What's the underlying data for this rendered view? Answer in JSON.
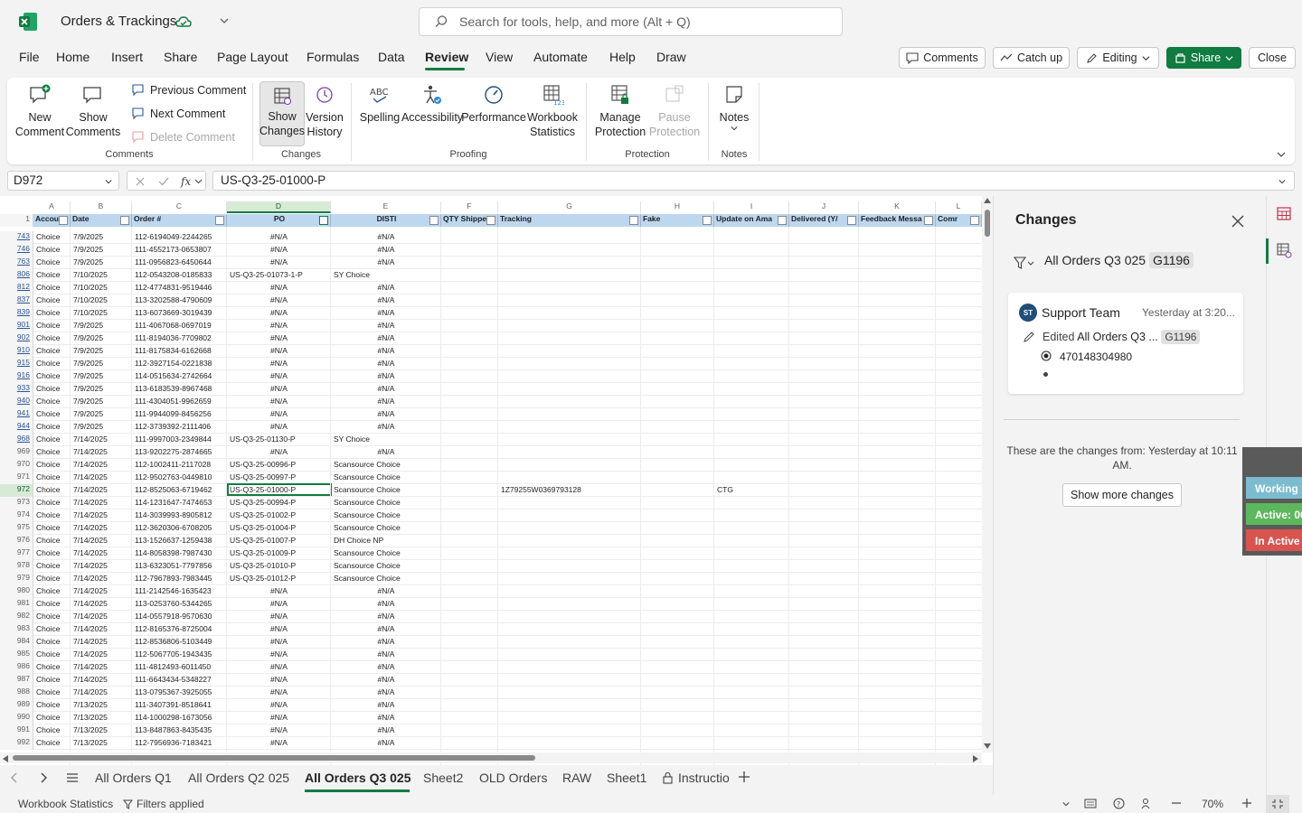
{
  "app": {
    "title": "Orders & Trackings",
    "search_placeholder": "Search for tools, help, and more (Alt + Q)"
  },
  "menu": {
    "tabs": [
      "File",
      "Home",
      "Insert",
      "Share",
      "Page Layout",
      "Formulas",
      "Data",
      "Review",
      "View",
      "Automate",
      "Help",
      "Draw"
    ],
    "active": "Review",
    "comments": "Comments",
    "catch_up": "Catch up",
    "editing": "Editing",
    "share": "Share",
    "close": "Close"
  },
  "ribbon": {
    "new_comment": "New Comment",
    "show_comments": "Show Comments",
    "previous_comment": "Previous Comment",
    "next_comment": "Next Comment",
    "delete_comment": "Delete Comment",
    "group_comments": "Comments",
    "show_changes": "Show Changes",
    "version_history": "Version History",
    "group_changes": "Changes",
    "spelling": "Spelling",
    "accessibility": "Accessibility",
    "performance": "Performance",
    "workbook_statistics": "Workbook Statistics",
    "group_proofing": "Proofing",
    "manage_protection": "Manage Protection",
    "pause_protection": "Pause Protection",
    "group_protection": "Protection",
    "notes": "Notes",
    "group_notes": "Notes"
  },
  "formula_bar": {
    "name_box": "D972",
    "formula": "US-Q3-25-01000-P"
  },
  "grid": {
    "columns": [
      "A",
      "B",
      "C",
      "D",
      "E",
      "F",
      "G",
      "H",
      "I",
      "J",
      "K",
      "L"
    ],
    "headers": [
      "Accou",
      "Date",
      "Order #",
      "PO",
      "DISTI",
      "QTY Shippe",
      "Tracking",
      "Fake",
      "Update on Ama",
      "Delivered (Y/",
      "Feedback Messa",
      "Comr"
    ],
    "rows": [
      {
        "n": "743",
        "a": "Choice",
        "b": "7/9/2025",
        "c": "112-6194049-2244265",
        "d": "#N/A",
        "e": "#N/A"
      },
      {
        "n": "746",
        "a": "Choice",
        "b": "7/9/2025",
        "c": "111-4552173-0653807",
        "d": "#N/A",
        "e": "#N/A"
      },
      {
        "n": "763",
        "a": "Choice",
        "b": "7/9/2025",
        "c": "111-0956823-6450644",
        "d": "#N/A",
        "e": "#N/A"
      },
      {
        "n": "806",
        "a": "Choice",
        "b": "7/10/2025",
        "c": "112-0543208-0185833",
        "d": "US-Q3-25-01073-1-P",
        "e": "SY Choice"
      },
      {
        "n": "812",
        "a": "Choice",
        "b": "7/10/2025",
        "c": "112-4774831-9519446",
        "d": "#N/A",
        "e": "#N/A"
      },
      {
        "n": "837",
        "a": "Choice",
        "b": "7/10/2025",
        "c": "113-3202588-4790609",
        "d": "#N/A",
        "e": "#N/A"
      },
      {
        "n": "839",
        "a": "Choice",
        "b": "7/10/2025",
        "c": "113-6073669-3019439",
        "d": "#N/A",
        "e": "#N/A"
      },
      {
        "n": "901",
        "a": "Choice",
        "b": "7/9/2025",
        "c": "111-4067068-0697019",
        "d": "#N/A",
        "e": "#N/A"
      },
      {
        "n": "902",
        "a": "Choice",
        "b": "7/9/2025",
        "c": "111-8194036-7709802",
        "d": "#N/A",
        "e": "#N/A"
      },
      {
        "n": "910",
        "a": "Choice",
        "b": "7/9/2025",
        "c": "111-8175834-6162668",
        "d": "#N/A",
        "e": "#N/A"
      },
      {
        "n": "915",
        "a": "Choice",
        "b": "7/9/2025",
        "c": "112-3927154-0221838",
        "d": "#N/A",
        "e": "#N/A"
      },
      {
        "n": "916",
        "a": "Choice",
        "b": "7/9/2025",
        "c": "114-0515634-2742664",
        "d": "#N/A",
        "e": "#N/A"
      },
      {
        "n": "933",
        "a": "Choice",
        "b": "7/9/2025",
        "c": "113-6183539-8967468",
        "d": "#N/A",
        "e": "#N/A"
      },
      {
        "n": "940",
        "a": "Choice",
        "b": "7/9/2025",
        "c": "111-4304051-9962659",
        "d": "#N/A",
        "e": "#N/A"
      },
      {
        "n": "941",
        "a": "Choice",
        "b": "7/9/2025",
        "c": "111-9944099-8456256",
        "d": "#N/A",
        "e": "#N/A"
      },
      {
        "n": "944",
        "a": "Choice",
        "b": "7/9/2025",
        "c": "112-3739392-2111406",
        "d": "#N/A",
        "e": "#N/A"
      },
      {
        "n": "968",
        "a": "Choice",
        "b": "7/14/2025",
        "c": "111-9997003-2349844",
        "d": "US-Q3-25-01130-P",
        "e": "SY Choice"
      },
      {
        "n": "969",
        "a": "Choice",
        "b": "7/14/2025",
        "c": "113-9202275-2874665",
        "d": "#N/A",
        "e": "#N/A"
      },
      {
        "n": "970",
        "a": "Choice",
        "b": "7/14/2025",
        "c": "112-1002411-2117028",
        "d": "US-Q3-25-00996-P",
        "e": "Scansource Choice"
      },
      {
        "n": "971",
        "a": "Choice",
        "b": "7/14/2025",
        "c": "112-9502763-0449810",
        "d": "US-Q3-25-00997-P",
        "e": "Scansource Choice"
      },
      {
        "n": "972",
        "a": "Choice",
        "b": "7/14/2025",
        "c": "112-8525063-6719462",
        "d": "US-Q3-25-01000-P",
        "e": "Scansource Choice",
        "g": "1Z79255W0369793128",
        "i": "CTG"
      },
      {
        "n": "973",
        "a": "Choice",
        "b": "7/14/2025",
        "c": "114-1231647-7474653",
        "d": "US-Q3-25-00994-P",
        "e": "Scansource Choice"
      },
      {
        "n": "974",
        "a": "Choice",
        "b": "7/14/2025",
        "c": "114-3039993-8905812",
        "d": "US-Q3-25-01002-P",
        "e": "Scansource Choice"
      },
      {
        "n": "975",
        "a": "Choice",
        "b": "7/14/2025",
        "c": "112-3620306-6708205",
        "d": "US-Q3-25-01004-P",
        "e": "Scansource Choice"
      },
      {
        "n": "976",
        "a": "Choice",
        "b": "7/14/2025",
        "c": "113-1526637-1259438",
        "d": "US-Q3-25-01007-P",
        "e": "DH Choice NP"
      },
      {
        "n": "977",
        "a": "Choice",
        "b": "7/14/2025",
        "c": "114-8058398-7987430",
        "d": "US-Q3-25-01009-P",
        "e": "Scansource Choice"
      },
      {
        "n": "978",
        "a": "Choice",
        "b": "7/14/2025",
        "c": "113-6323051-7797856",
        "d": "US-Q3-25-01010-P",
        "e": "Scansource Choice"
      },
      {
        "n": "979",
        "a": "Choice",
        "b": "7/14/2025",
        "c": "112-7967893-7983445",
        "d": "US-Q3-25-01012-P",
        "e": "Scansource Choice"
      },
      {
        "n": "980",
        "a": "Choice",
        "b": "7/14/2025",
        "c": "111-2142546-1635423",
        "d": "#N/A",
        "e": "#N/A"
      },
      {
        "n": "981",
        "a": "Choice",
        "b": "7/14/2025",
        "c": "113-0253760-5344265",
        "d": "#N/A",
        "e": "#N/A"
      },
      {
        "n": "982",
        "a": "Choice",
        "b": "7/14/2025",
        "c": "114-0557918-9570630",
        "d": "#N/A",
        "e": "#N/A"
      },
      {
        "n": "983",
        "a": "Choice",
        "b": "7/14/2025",
        "c": "112-8165376-8725004",
        "d": "#N/A",
        "e": "#N/A"
      },
      {
        "n": "984",
        "a": "Choice",
        "b": "7/14/2025",
        "c": "112-8536806-5103449",
        "d": "#N/A",
        "e": "#N/A"
      },
      {
        "n": "985",
        "a": "Choice",
        "b": "7/14/2025",
        "c": "112-5067705-1943435",
        "d": "#N/A",
        "e": "#N/A"
      },
      {
        "n": "986",
        "a": "Choice",
        "b": "7/14/2025",
        "c": "111-4812493-6011450",
        "d": "#N/A",
        "e": "#N/A"
      },
      {
        "n": "987",
        "a": "Choice",
        "b": "7/14/2025",
        "c": "111-6643434-5348227",
        "d": "#N/A",
        "e": "#N/A"
      },
      {
        "n": "988",
        "a": "Choice",
        "b": "7/14/2025",
        "c": "113-0795367-3925055",
        "d": "#N/A",
        "e": "#N/A"
      },
      {
        "n": "989",
        "a": "Choice",
        "b": "7/13/2025",
        "c": "111-3407391-8518641",
        "d": "#N/A",
        "e": "#N/A"
      },
      {
        "n": "990",
        "a": "Choice",
        "b": "7/13/2025",
        "c": "114-1000298-1673056",
        "d": "#N/A",
        "e": "#N/A"
      },
      {
        "n": "991",
        "a": "Choice",
        "b": "7/13/2025",
        "c": "113-8487863-8435435",
        "d": "#N/A",
        "e": "#N/A"
      },
      {
        "n": "992",
        "a": "Choice",
        "b": "7/13/2025",
        "c": "112-7956936-7183421",
        "d": "#N/A",
        "e": "#N/A"
      }
    ],
    "current_row": "972",
    "header_row_number": "1"
  },
  "sheets": {
    "tabs": [
      "All Orders Q1",
      "All Orders Q2 025",
      "All Orders Q3 025",
      "Sheet2",
      "OLD Orders",
      "RAW",
      "Sheet1",
      "Instructio"
    ],
    "active": "All Orders Q3 025"
  },
  "status": {
    "workbook_statistics": "Workbook Statistics",
    "filters": "Filters applied",
    "zoom": "70%"
  },
  "changes_pane": {
    "title": "Changes",
    "filter_sheet": "All Orders Q3 025",
    "filter_cell": "G1196",
    "card": {
      "initials": "ST",
      "author": "Support Team",
      "time": "Yesterday at 3:20...",
      "edited_label": "Edited",
      "edited_target": "All Orders Q3 ...",
      "cell": "G1196",
      "value": "470148304980"
    },
    "note": "These are the changes from: Yesterday at 10:11 AM.",
    "more_button": "Show more changes"
  },
  "overlay": {
    "items": [
      "Working",
      "Active: 00",
      "In Active"
    ],
    "colors": [
      "#7bbcd0",
      "#5cb85c",
      "#d9534f"
    ]
  },
  "colors": {
    "accent": "#107c41",
    "header_fill": "#bdd7ee"
  }
}
